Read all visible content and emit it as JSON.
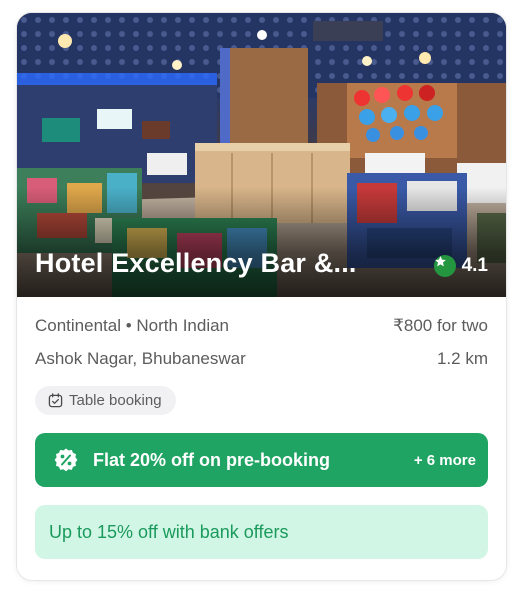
{
  "restaurant": {
    "name": "Hotel Excellency Bar &...",
    "rating": "4.1",
    "cuisines": "Continental • North Indian",
    "price": "₹800 for two",
    "location": "Ashok Nagar, Bhubaneswar",
    "distance": "1.2 km"
  },
  "chip": {
    "label": "Table booking",
    "icon": "calendar-check-icon"
  },
  "offers": {
    "main_text": "Flat 20% off on pre-booking",
    "more_text": "+ 6 more",
    "bank_text": "Up to 15% off with bank offers"
  },
  "colors": {
    "rating_badge": "#24963f",
    "offer_green": "#1fa463",
    "bank_bg": "#d2f6e5",
    "bank_text": "#1a9a5c"
  }
}
